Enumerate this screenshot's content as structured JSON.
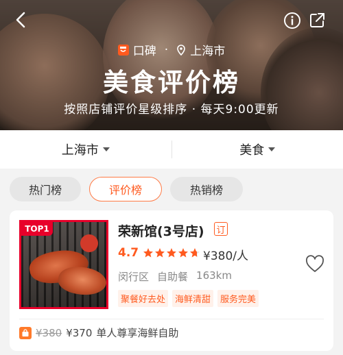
{
  "header": {
    "brand": "口碑",
    "city": "上海市",
    "title": "美食评价榜",
    "subtitle": "按照店铺评价星级排序 · 每天9:00更新"
  },
  "filters": [
    {
      "label": "上海市"
    },
    {
      "label": "美食"
    }
  ],
  "tabs": [
    {
      "label": "热门榜",
      "active": false
    },
    {
      "label": "评价榜",
      "active": true
    },
    {
      "label": "热销榜",
      "active": false
    }
  ],
  "shop": {
    "rank_badge": "TOP1",
    "name": "荣新馆(3号店)",
    "booking_mark": "订",
    "rating": "4.7",
    "star_value": 4.7,
    "price": "¥380/人",
    "district": "闵行区",
    "category": "自助餐",
    "distance": "163km",
    "tags": [
      "聚餐好去处",
      "海鲜清甜",
      "服务完美"
    ],
    "deal": {
      "original_price": "¥380",
      "price": "¥370",
      "description": "单人尊享海鲜自助"
    }
  },
  "colors": {
    "accent": "#ff5a1f",
    "badge_red": "#e8002a"
  },
  "icons": {
    "back": "chevron-left-icon",
    "info": "info-icon",
    "share": "share-icon",
    "location": "location-pin-icon",
    "favorite": "heart-icon",
    "deal": "shopping-bag-icon"
  }
}
